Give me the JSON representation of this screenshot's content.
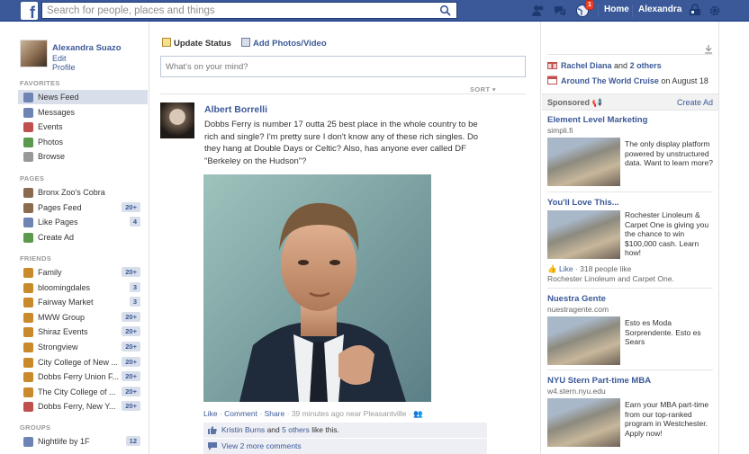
{
  "topbar": {
    "logo_letter": "f",
    "search_placeholder": "Search for people, places and things",
    "notifications_count": "1",
    "home_label": "Home",
    "user_label": "Alexandra"
  },
  "leftnav": {
    "profile_name": "Alexandra Suazo",
    "edit_profile": "Edit Profile",
    "sections": {
      "favorites": "FAVORITES",
      "pages": "PAGES",
      "friends": "FRIENDS",
      "groups": "GROUPS"
    },
    "favorites": [
      {
        "label": "News Feed",
        "icon": "news-feed-icon",
        "count": ""
      },
      {
        "label": "Messages",
        "icon": "messages-icon",
        "count": ""
      },
      {
        "label": "Events",
        "icon": "events-icon",
        "count": ""
      },
      {
        "label": "Photos",
        "icon": "photos-icon",
        "count": ""
      },
      {
        "label": "Browse",
        "icon": "browse-icon",
        "count": ""
      }
    ],
    "pages": [
      {
        "label": "Bronx Zoo's Cobra",
        "icon": "page-icon",
        "count": ""
      },
      {
        "label": "Pages Feed",
        "icon": "pages-feed-icon",
        "count": "20+"
      },
      {
        "label": "Like Pages",
        "icon": "like-pages-icon",
        "count": "4"
      },
      {
        "label": "Create Ad",
        "icon": "create-ad-icon",
        "count": ""
      }
    ],
    "friends": [
      {
        "label": "Family",
        "icon": "family-icon",
        "count": "20+"
      },
      {
        "label": "bloomingdales",
        "icon": "list-icon",
        "count": "3"
      },
      {
        "label": "Fairway Market",
        "icon": "list-icon",
        "count": "3"
      },
      {
        "label": "MWW Group",
        "icon": "list-icon",
        "count": "20+"
      },
      {
        "label": "Shiraz Events",
        "icon": "list-icon",
        "count": "20+"
      },
      {
        "label": "Strongview",
        "icon": "list-icon",
        "count": "20+"
      },
      {
        "label": "City College of New ...",
        "icon": "list-icon",
        "count": "20+"
      },
      {
        "label": "Dobbs Ferry Union F...",
        "icon": "list-icon",
        "count": "20+"
      },
      {
        "label": "The City College of ...",
        "icon": "list-icon",
        "count": "20+"
      },
      {
        "label": "Dobbs Ferry, New Y...",
        "icon": "location-icon",
        "count": "20+"
      }
    ],
    "groups": [
      {
        "label": "Nightlife by 1F",
        "icon": "group-icon",
        "count": "12"
      }
    ]
  },
  "composer": {
    "update_status": "Update Status",
    "add_photos": "Add Photos/Video",
    "placeholder": "What's on your mind?",
    "sort": "SORT"
  },
  "post": {
    "author": "Albert Borrelli",
    "text": "Dobbs Ferry is number 17 outta 25 best place in the whole country to be rich and single? I'm pretty sure I don't know any of these rich singles. Do they hang at Double Days or Celtic? Also, has anyone ever called DF \"Berkeley on the Hudson\"?",
    "like": "Like",
    "comment": "Comment",
    "share": "Share",
    "time": "39 minutes ago near Pleasantville",
    "likes_name": "Kristin Burns",
    "likes_and": "and",
    "likes_others": "5 others",
    "likes_suffix": "like this.",
    "view_comments": "View 2 more comments"
  },
  "right": {
    "events": [
      {
        "name": "Rachel Diana",
        "mid": "and",
        "link": "2 others",
        "suffix": ""
      },
      {
        "name": "Around The World Cruise",
        "mid": "on August 18",
        "link": "",
        "suffix": ""
      }
    ],
    "sponsored": "Sponsored",
    "create_ad": "Create Ad",
    "ads": [
      {
        "title": "Element Level Marketing",
        "url": "simpli.fi",
        "desc": "The only display platform powered by unstructured data. Want to learn more?"
      },
      {
        "title": "You'll Love This...",
        "url": "",
        "desc": "Rochester Linoleum & Carpet One is giving you the chance to win $100,000 cash. Learn how!",
        "like": "Like",
        "like_count": "318 people like",
        "like_page": "Rochester Linoleum and Carpet One."
      },
      {
        "title": "Nuestra Gente",
        "url": "nuestragente.com",
        "desc": "Esto es Moda Sorprendente. Esto es Sears"
      },
      {
        "title": "NYU Stern Part-time MBA",
        "url": "w4.stern.nyu.edu",
        "desc": "Earn your MBA part-time from our top-ranked program in Westchester. Apply now!"
      }
    ]
  },
  "colors": {
    "brand": "#3b5998",
    "nav_active": "#d8dfea",
    "notification": "#f03d25"
  }
}
